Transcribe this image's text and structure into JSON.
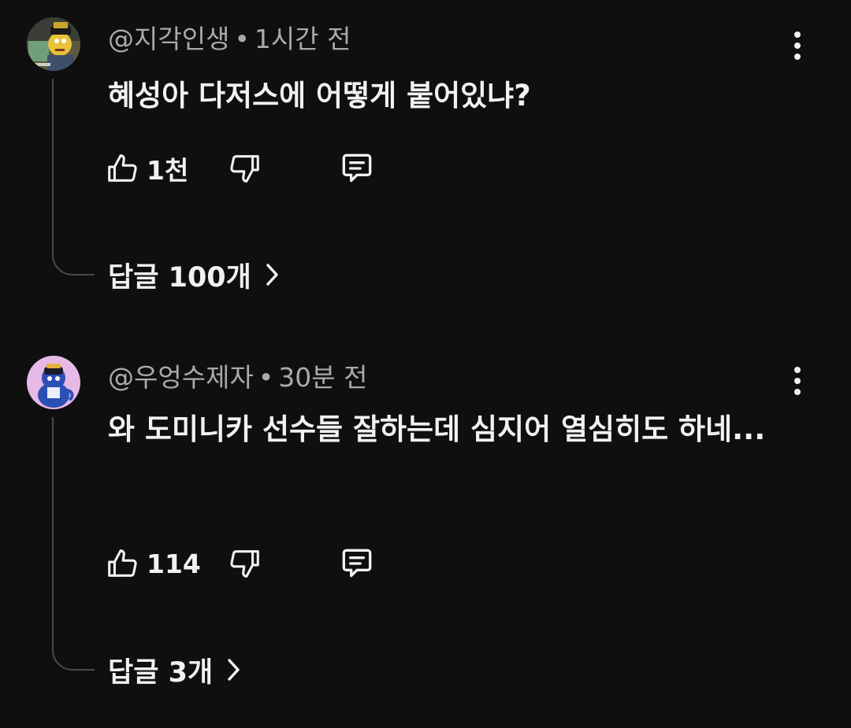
{
  "comments": [
    {
      "author": "@지각인생",
      "separator": "•",
      "time": "1시간 전",
      "text": "혜성아 다저스에 어떻게 붙어있냐?",
      "likes": "1천",
      "replies_label": "답글 100개",
      "avatar_icon": "cartoon-character-avatar"
    },
    {
      "author": "@우엉수제자",
      "separator": "•",
      "time": "30분 전",
      "text": "와 도미니카 선수들 잘하는데 심지어 열심히도 하네...",
      "likes": "114",
      "replies_label": "답글 3개",
      "avatar_icon": "blue-creature-avatar"
    }
  ],
  "colors": {
    "background": "#0f0f0f",
    "primary_text": "#f1f1f1",
    "secondary_text": "#aaaaaa",
    "thread_line": "#4a4a4a"
  }
}
